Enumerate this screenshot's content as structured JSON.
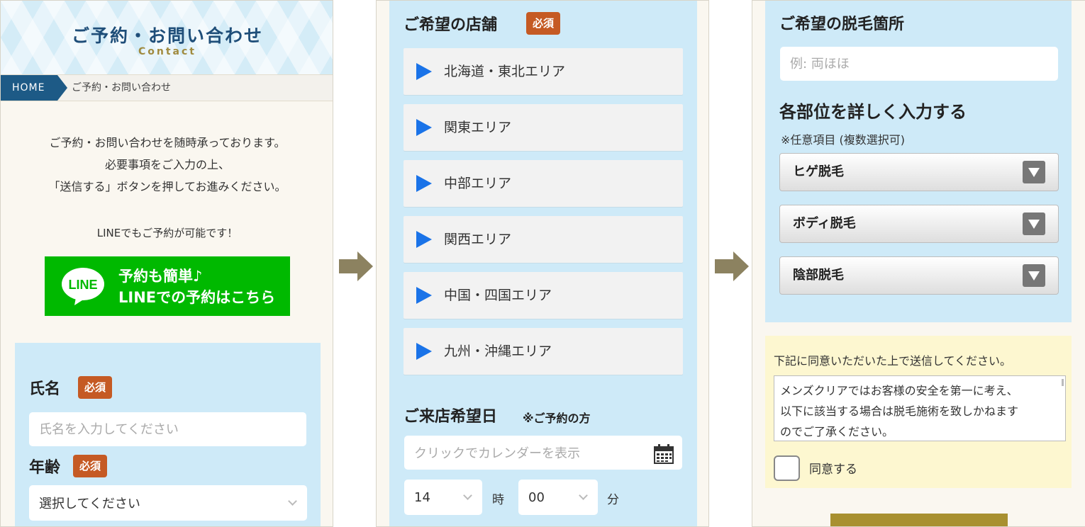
{
  "panel1": {
    "hero_title": "ご予約・お問い合わせ",
    "hero_subtitle": "Contact",
    "breadcrumb": {
      "home": "HOME",
      "current": "ご予約・お問い合わせ"
    },
    "intro_lines": [
      "ご予約・お問い合わせを随時承っております。",
      "必要事項をご入力の上、",
      "「送信する」ボタンを押してお進みください。"
    ],
    "line_note": "LINEでもご予約が可能です！",
    "line_button": {
      "logo": "LINE",
      "line1": "予約も簡単♪",
      "line2": "LINEでの予約はこちら"
    },
    "name_field": {
      "label": "氏名",
      "required": "必須",
      "placeholder": "氏名を入力してください"
    },
    "age_field": {
      "label": "年齢",
      "required": "必須",
      "value": "選択してください"
    }
  },
  "panel2": {
    "store": {
      "label": "ご希望の店舗",
      "required": "必須"
    },
    "areas": [
      "北海道・東北エリア",
      "関東エリア",
      "中部エリア",
      "関西エリア",
      "中国・四国エリア",
      "九州・沖縄エリア"
    ],
    "visit": {
      "label": "ご来店希望日",
      "note": "※ご予約の方",
      "placeholder": "クリックでカレンダーを表示"
    },
    "time": {
      "hour": "14",
      "hour_unit": "時",
      "minute": "00",
      "minute_unit": "分"
    }
  },
  "panel3": {
    "part": {
      "label": "ご希望の脱毛箇所",
      "placeholder": "例: 両ほほ"
    },
    "detail": {
      "label": "各部位を詳しく入力する",
      "note": "※任意項目 (複数選択可)"
    },
    "dropdowns": [
      "ヒゲ脱毛",
      "ボディ脱毛",
      "陰部脱毛"
    ],
    "agree": {
      "instruction": "下記に同意いただいた上で送信してください。",
      "terms_lines": [
        "メンズクリアではお客様の安全を第一に考え、",
        "以下に該当する場合は脱毛施術を致しかねます",
        "のでご了承ください。"
      ],
      "checkbox_label": "同意する"
    }
  },
  "colors": {
    "accent_blue": "#1d5a86",
    "required_badge": "#c55a24",
    "line_green": "#00b900",
    "form_bg": "#ceeaf8",
    "arrow": "#8c8260"
  }
}
